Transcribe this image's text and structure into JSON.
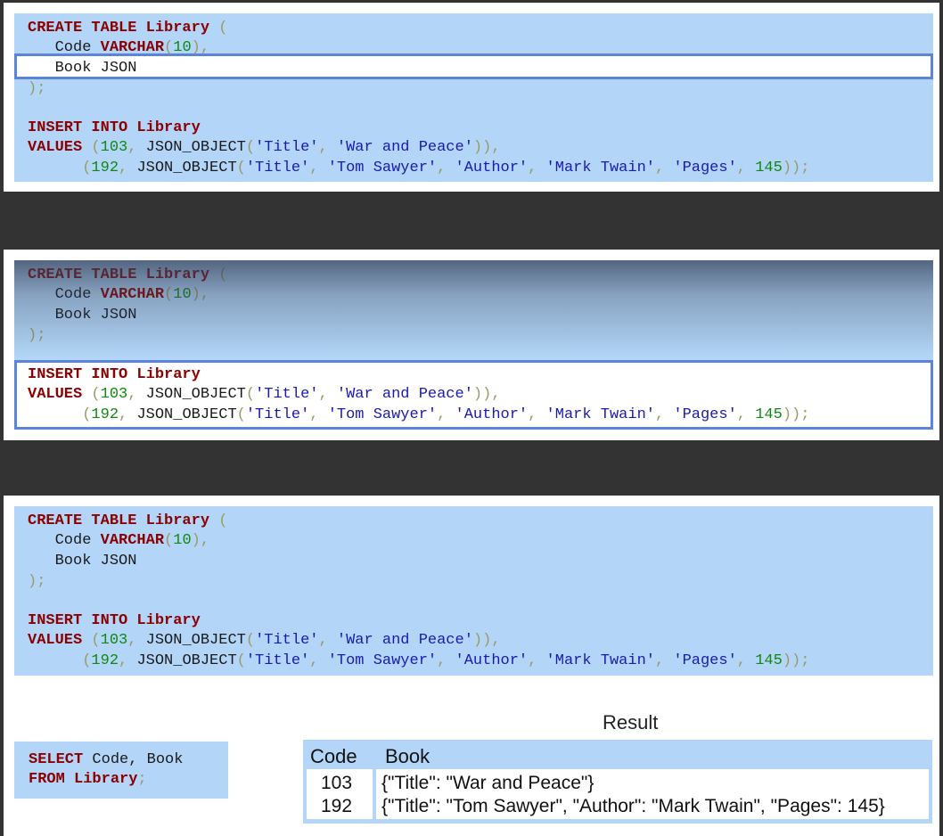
{
  "colors": {
    "background": "#333333",
    "code_bg": "#b3d6f8",
    "keyword": "#8b0000",
    "number": "#118811",
    "string": "#1a1ab0",
    "highlight_border": "#5b85d8"
  },
  "code": {
    "create_kw": "CREATE TABLE Library",
    "open_paren": " (",
    "code_col": "   Code ",
    "varchar_kw": "VARCHAR",
    "varchar_args_open": "(",
    "varchar_len": "10",
    "varchar_args_close": "),",
    "book_col": "   Book JSON",
    "close": ");",
    "insert_kw": "INSERT INTO Library",
    "values_kw": "VALUES",
    "row1_open": " (",
    "row1_code": "103",
    "row1_sep": ", JSON_OBJECT",
    "paren_open": "(",
    "title_key": "'Title'",
    "comma": ", ",
    "title1": "'War and Peace'",
    "row1_close": "))",
    "row1_end": ",",
    "row2_indent": "      ",
    "row2_open": "(",
    "row2_code": "192",
    "title2": "'Tom Sawyer'",
    "author_key": "'Author'",
    "author_val": "'Mark Twain'",
    "pages_key": "'Pages'",
    "pages_val": "145",
    "row2_close": "));"
  },
  "select": {
    "select_kw": "SELECT",
    "select_cols": " Code, Book",
    "from_kw": "FROM Library",
    "semicolon": ";"
  },
  "result": {
    "title": "Result",
    "headers": [
      "Code",
      "Book"
    ],
    "rows": [
      [
        "103",
        "{\"Title\": \"War and Peace\"}"
      ],
      [
        "192",
        "{\"Title\": \"Tom Sawyer\", \"Author\": \"Mark Twain\", \"Pages\": 145}"
      ]
    ]
  }
}
